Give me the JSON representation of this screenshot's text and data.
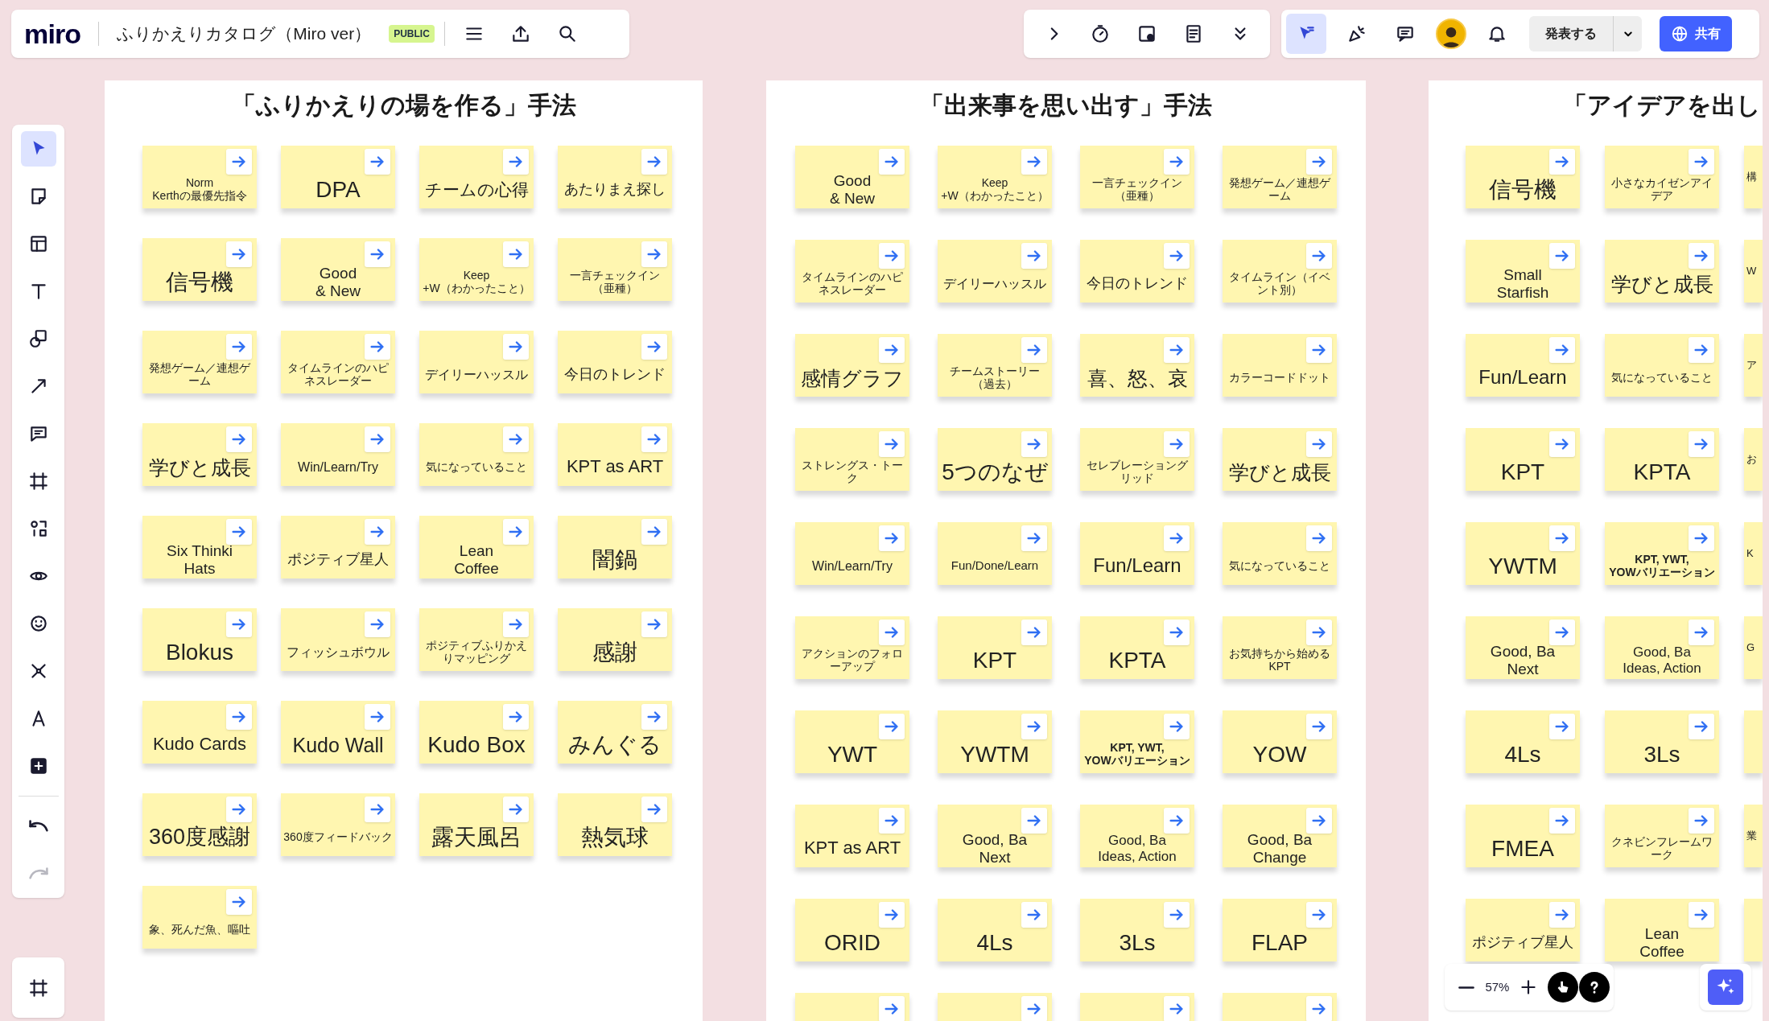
{
  "top_bar": {
    "logo": "miro",
    "board_title": "ふりかえりカタログ（Miro ver）",
    "badge": "PUBLIC",
    "collab_tools": [
      {
        "kind": "follow",
        "selected": true
      },
      {
        "kind": "reactions",
        "selected": false
      },
      {
        "kind": "comments",
        "selected": false
      }
    ],
    "present_button": "発表する",
    "share_button": "共有"
  },
  "left_toolbar": [
    {
      "kind": "select",
      "selected": true
    },
    {
      "kind": "sticky",
      "selected": false
    },
    {
      "kind": "template",
      "selected": false
    },
    {
      "kind": "text",
      "selected": false
    },
    {
      "kind": "shapes",
      "selected": false
    },
    {
      "kind": "line",
      "selected": false
    },
    {
      "kind": "comment",
      "selected": false
    },
    {
      "kind": "frame",
      "selected": false
    },
    {
      "kind": "diagram",
      "selected": false
    },
    {
      "kind": "eye",
      "selected": false
    },
    {
      "kind": "emoji",
      "selected": false
    },
    {
      "kind": "mindmap",
      "selected": false
    },
    {
      "kind": "pen",
      "selected": false
    },
    {
      "kind": "add",
      "selected": false
    }
  ],
  "history": [
    {
      "kind": "undo",
      "disabled": false
    },
    {
      "kind": "redo",
      "disabled": true
    }
  ],
  "frames": [
    {
      "title": "「ふりかえりの場を作る」手法",
      "stickies": [
        {
          "kind": "note",
          "text": "Norm\nKerthの最優先指令"
        },
        {
          "kind": "note",
          "text": "DPA"
        },
        {
          "kind": "note",
          "text": "チームの心得"
        },
        {
          "kind": "note",
          "text": "あたりまえ探し"
        },
        {
          "kind": "note",
          "text": "信号機"
        },
        {
          "kind": "note",
          "text": "Good\n& New"
        },
        {
          "kind": "note",
          "text": "Keep\n+W（わかったこと）"
        },
        {
          "kind": "note",
          "text": "一言チェックイン（亜種）"
        },
        {
          "kind": "note",
          "text": "発想ゲーム／連想ゲーム"
        },
        {
          "kind": "note",
          "text": "タイムラインのハピネスレーダー"
        },
        {
          "kind": "note",
          "text": "デイリーハッスル"
        },
        {
          "kind": "note",
          "text": "今日のトレンド"
        },
        {
          "kind": "note",
          "text": "学びと成長"
        },
        {
          "kind": "note",
          "text": "Win/Learn/Try"
        },
        {
          "kind": "note",
          "text": "気になっていること"
        },
        {
          "kind": "note",
          "text": "KPT as ART"
        },
        {
          "kind": "note",
          "text": "Six Thinki\nHats"
        },
        {
          "kind": "note",
          "text": "ポジティブ星人"
        },
        {
          "kind": "note",
          "text": "Lean\nCoffee"
        },
        {
          "kind": "note",
          "text": "闇鍋"
        },
        {
          "kind": "note",
          "text": "Blokus"
        },
        {
          "kind": "note",
          "text": "フィッシュボウル"
        },
        {
          "kind": "note",
          "text": "ポジティブふりかえりマッピング"
        },
        {
          "kind": "note",
          "text": "感謝"
        },
        {
          "kind": "note",
          "text": "Kudo Cards"
        },
        {
          "kind": "note",
          "text": "Kudo Wall"
        },
        {
          "kind": "note",
          "text": "Kudo Box"
        },
        {
          "kind": "note",
          "text": "みんぐる"
        },
        {
          "kind": "note",
          "text": "360度感謝"
        },
        {
          "kind": "note",
          "text": "360度フィードバック"
        },
        {
          "kind": "note",
          "text": "露天風呂"
        },
        {
          "kind": "note",
          "text": "熱気球"
        },
        {
          "kind": "note",
          "text": "象、死んだ魚、嘔吐"
        }
      ]
    },
    {
      "title": "「出来事を思い出す」手法",
      "stickies": [
        {
          "kind": "note",
          "text": "Good\n& New"
        },
        {
          "kind": "note",
          "text": "Keep\n+W（わかったこと）"
        },
        {
          "kind": "note",
          "text": "一言チェックイン（亜種）"
        },
        {
          "kind": "note",
          "text": "発想ゲーム／連想ゲーム"
        },
        {
          "kind": "note",
          "text": "タイムラインのハピネスレーダー"
        },
        {
          "kind": "note",
          "text": "デイリーハッスル"
        },
        {
          "kind": "note",
          "text": "今日のトレンド"
        },
        {
          "kind": "note",
          "text": "タイムライン（イベント別）"
        },
        {
          "kind": "note",
          "text": "感情グラフ"
        },
        {
          "kind": "note",
          "text": "チームストーリー（過去）"
        },
        {
          "kind": "note",
          "text": "喜、怒、哀"
        },
        {
          "kind": "note",
          "text": "カラーコードドット"
        },
        {
          "kind": "note",
          "text": "ストレングス・トーク"
        },
        {
          "kind": "note",
          "text": "5つのなぜ"
        },
        {
          "kind": "note",
          "text": "セレブレーショングリッド"
        },
        {
          "kind": "note",
          "text": "学びと成長"
        },
        {
          "kind": "note",
          "text": "Win/Learn/Try"
        },
        {
          "kind": "note",
          "text": "Fun/Done/Learn"
        },
        {
          "kind": "note",
          "text": "Fun/Learn"
        },
        {
          "kind": "note",
          "text": "気になっていること"
        },
        {
          "kind": "note",
          "text": "アクションのフォローアップ"
        },
        {
          "kind": "note",
          "text": "KPT"
        },
        {
          "kind": "note",
          "text": "KPTA"
        },
        {
          "kind": "note",
          "text": "お気持ちから始めるKPT"
        },
        {
          "kind": "note",
          "text": "YWT"
        },
        {
          "kind": "note",
          "text": "YWTM"
        },
        {
          "kind": "bold-note",
          "text": "KPT, YWT,\nYOWバリエーション"
        },
        {
          "kind": "note",
          "text": "YOW"
        },
        {
          "kind": "note",
          "text": "KPT as ART"
        },
        {
          "kind": "note",
          "text": "Good, Ba\nNext"
        },
        {
          "kind": "note",
          "text": "Good, Ba\nIdeas, Action"
        },
        {
          "kind": "note",
          "text": "Good, Ba\nChange"
        },
        {
          "kind": "note",
          "text": "ORID"
        },
        {
          "kind": "note",
          "text": "4Ls"
        },
        {
          "kind": "note",
          "text": "3Ls"
        },
        {
          "kind": "note",
          "text": "FLAP"
        },
        {
          "kind": "blank"
        },
        {
          "kind": "blank"
        },
        {
          "kind": "blank"
        },
        {
          "kind": "blank"
        }
      ]
    },
    {
      "title": "「アイデアを出し",
      "stickies": [
        {
          "kind": "note",
          "text": "信号機"
        },
        {
          "kind": "note",
          "text": "小さなカイゼンアイデア"
        },
        {
          "kind": "edge",
          "text": "構"
        },
        {
          "kind": "note",
          "text": "Small\nStarfish"
        },
        {
          "kind": "note",
          "text": "学びと成長"
        },
        {
          "kind": "edge",
          "text": "W"
        },
        {
          "kind": "note",
          "text": "Fun/Learn"
        },
        {
          "kind": "note",
          "text": "気になっていること"
        },
        {
          "kind": "edge",
          "text": "ア"
        },
        {
          "kind": "note",
          "text": "KPT"
        },
        {
          "kind": "note",
          "text": "KPTA"
        },
        {
          "kind": "edge",
          "text": "お"
        },
        {
          "kind": "note",
          "text": "YWTM"
        },
        {
          "kind": "bold-note",
          "text": "KPT, YWT,\nYOWバリエーション"
        },
        {
          "kind": "edge",
          "text": "K"
        },
        {
          "kind": "note",
          "text": "Good, Ba\nNext"
        },
        {
          "kind": "note",
          "text": "Good, Ba\nIdeas, Action"
        },
        {
          "kind": "edge",
          "text": "G"
        },
        {
          "kind": "note",
          "text": "4Ls"
        },
        {
          "kind": "note",
          "text": "3Ls"
        },
        {
          "kind": "edge"
        },
        {
          "kind": "note",
          "text": "FMEA"
        },
        {
          "kind": "note",
          "text": "クネビンフレームワーク"
        },
        {
          "kind": "edge",
          "text": "業"
        },
        {
          "kind": "note",
          "text": "ポジティブ星人"
        },
        {
          "kind": "note",
          "text": "Lean\nCoffee"
        },
        {
          "kind": "edge"
        }
      ]
    }
  ],
  "zoom": {
    "level_text": "57%"
  }
}
